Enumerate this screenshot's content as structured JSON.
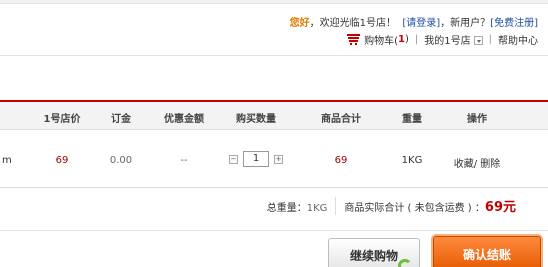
{
  "header": {
    "greeting": "您好",
    "welcome_text": "，欢迎光临1号店！",
    "login_link": "[请登录]",
    "new_user_text": "，新用户？",
    "register_link": "[免费注册]",
    "cart_label": "购物车(",
    "cart_count": "1",
    "cart_close": ")",
    "my_store": "我的1号店",
    "help_center": "帮助中心",
    "separator": "|"
  },
  "table": {
    "columns": [
      "1号店价",
      "订金",
      "优惠金额",
      "购买数量",
      "商品合计",
      "重量",
      "操作"
    ],
    "row": {
      "name_fragment": "m",
      "price": "69",
      "deposit": "0.00",
      "discount": "--",
      "quantity": "1",
      "subtotal": "69",
      "weight": "1KG",
      "actions": "收藏/ 删除"
    }
  },
  "summary": {
    "total_weight_label": "总重量：",
    "total_weight": "1KG",
    "actual_total_label": "商品实际合计 ( 未包含运费 ) ：",
    "actual_total": "69元"
  },
  "buttons": {
    "continue_label": "继续购物",
    "confirm_label": "确认结账"
  },
  "icons": {
    "cart": "shopping-cart-icon",
    "dropdown": "chevron-down-icon",
    "minus": "minus-icon",
    "plus": "plus-icon",
    "loading": "loading-spinner-icon"
  },
  "colors": {
    "accent_red": "#c00000",
    "greeting_orange": "#e07b00",
    "link_blue": "#1c4fa8",
    "confirm_orange": "#ff6a00"
  }
}
